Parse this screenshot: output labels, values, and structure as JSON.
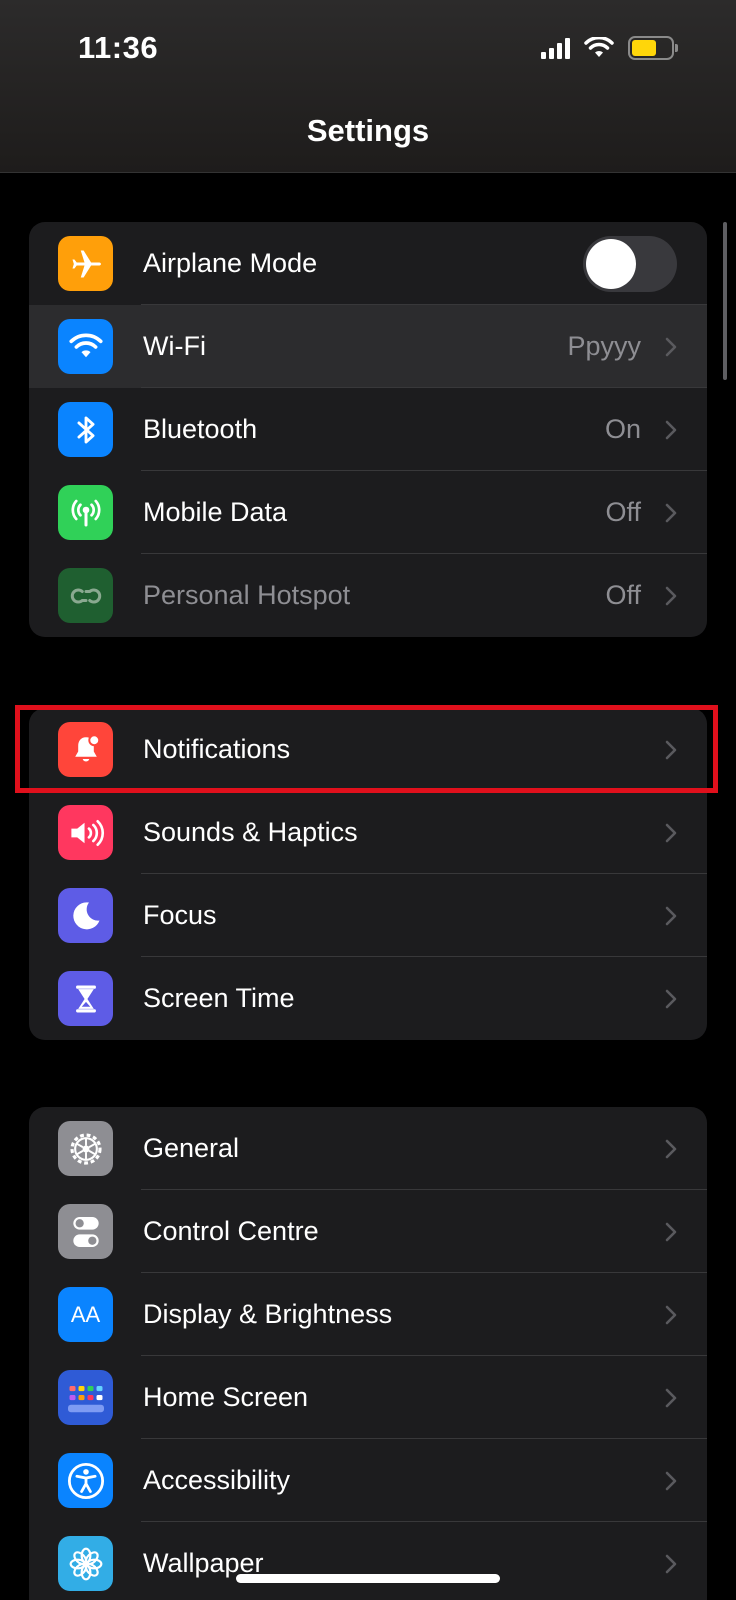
{
  "status_bar": {
    "time": "11:36",
    "battery_color": "#ffd60a"
  },
  "header": {
    "title": "Settings"
  },
  "groups": [
    {
      "rows": [
        {
          "icon": "airplane-icon",
          "icon_color": "#ff9f0a",
          "label": "Airplane Mode",
          "control": "toggle",
          "toggle_on": false
        },
        {
          "icon": "wifi-icon",
          "icon_color": "#0a84ff",
          "label": "Wi-Fi",
          "value": "Ppyyy",
          "highlighted": true
        },
        {
          "icon": "bluetooth-icon",
          "icon_color": "#0a84ff",
          "label": "Bluetooth",
          "value": "On"
        },
        {
          "icon": "antenna-icon",
          "icon_color": "#30d158",
          "label": "Mobile Data",
          "value": "Off"
        },
        {
          "icon": "hotspot-icon",
          "icon_color": "#1f5f30",
          "label": "Personal Hotspot",
          "value": "Off",
          "dimmed": true
        }
      ]
    },
    {
      "rows": [
        {
          "icon": "bell-icon",
          "icon_color": "#ff453a",
          "label": "Notifications"
        },
        {
          "icon": "speaker-icon",
          "icon_color": "#ff375f",
          "label": "Sounds & Haptics"
        },
        {
          "icon": "moon-icon",
          "icon_color": "#5e5ce6",
          "label": "Focus"
        },
        {
          "icon": "hourglass-icon",
          "icon_color": "#5e5ce6",
          "label": "Screen Time"
        }
      ]
    },
    {
      "rows": [
        {
          "icon": "gear-icon",
          "icon_color": "#8e8e93",
          "label": "General"
        },
        {
          "icon": "switches-icon",
          "icon_color": "#8e8e93",
          "label": "Control Centre"
        },
        {
          "icon": "text-size-icon",
          "icon_color": "#0a84ff",
          "label": "Display & Brightness"
        },
        {
          "icon": "home-grid-icon",
          "icon_color": "#2f5bd6",
          "label": "Home Screen"
        },
        {
          "icon": "accessibility-icon",
          "icon_color": "#0a84ff",
          "label": "Accessibility"
        },
        {
          "icon": "flower-icon",
          "icon_color": "#32ade6",
          "label": "Wallpaper"
        }
      ]
    }
  ],
  "icon_glyphs": {
    "text_size": "AA"
  },
  "highlight_box_color": "#e0101c"
}
